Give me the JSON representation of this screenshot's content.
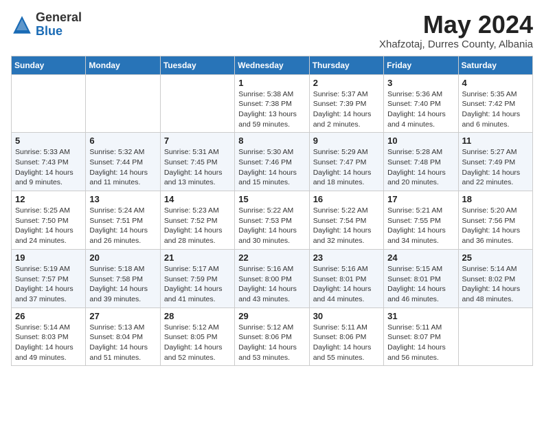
{
  "logo": {
    "general": "General",
    "blue": "Blue"
  },
  "title": {
    "month_year": "May 2024",
    "location": "Xhafzotaj, Durres County, Albania"
  },
  "headers": [
    "Sunday",
    "Monday",
    "Tuesday",
    "Wednesday",
    "Thursday",
    "Friday",
    "Saturday"
  ],
  "weeks": [
    [
      {
        "day": "",
        "info": ""
      },
      {
        "day": "",
        "info": ""
      },
      {
        "day": "",
        "info": ""
      },
      {
        "day": "1",
        "info": "Sunrise: 5:38 AM\nSunset: 7:38 PM\nDaylight: 13 hours\nand 59 minutes."
      },
      {
        "day": "2",
        "info": "Sunrise: 5:37 AM\nSunset: 7:39 PM\nDaylight: 14 hours\nand 2 minutes."
      },
      {
        "day": "3",
        "info": "Sunrise: 5:36 AM\nSunset: 7:40 PM\nDaylight: 14 hours\nand 4 minutes."
      },
      {
        "day": "4",
        "info": "Sunrise: 5:35 AM\nSunset: 7:42 PM\nDaylight: 14 hours\nand 6 minutes."
      }
    ],
    [
      {
        "day": "5",
        "info": "Sunrise: 5:33 AM\nSunset: 7:43 PM\nDaylight: 14 hours\nand 9 minutes."
      },
      {
        "day": "6",
        "info": "Sunrise: 5:32 AM\nSunset: 7:44 PM\nDaylight: 14 hours\nand 11 minutes."
      },
      {
        "day": "7",
        "info": "Sunrise: 5:31 AM\nSunset: 7:45 PM\nDaylight: 14 hours\nand 13 minutes."
      },
      {
        "day": "8",
        "info": "Sunrise: 5:30 AM\nSunset: 7:46 PM\nDaylight: 14 hours\nand 15 minutes."
      },
      {
        "day": "9",
        "info": "Sunrise: 5:29 AM\nSunset: 7:47 PM\nDaylight: 14 hours\nand 18 minutes."
      },
      {
        "day": "10",
        "info": "Sunrise: 5:28 AM\nSunset: 7:48 PM\nDaylight: 14 hours\nand 20 minutes."
      },
      {
        "day": "11",
        "info": "Sunrise: 5:27 AM\nSunset: 7:49 PM\nDaylight: 14 hours\nand 22 minutes."
      }
    ],
    [
      {
        "day": "12",
        "info": "Sunrise: 5:25 AM\nSunset: 7:50 PM\nDaylight: 14 hours\nand 24 minutes."
      },
      {
        "day": "13",
        "info": "Sunrise: 5:24 AM\nSunset: 7:51 PM\nDaylight: 14 hours\nand 26 minutes."
      },
      {
        "day": "14",
        "info": "Sunrise: 5:23 AM\nSunset: 7:52 PM\nDaylight: 14 hours\nand 28 minutes."
      },
      {
        "day": "15",
        "info": "Sunrise: 5:22 AM\nSunset: 7:53 PM\nDaylight: 14 hours\nand 30 minutes."
      },
      {
        "day": "16",
        "info": "Sunrise: 5:22 AM\nSunset: 7:54 PM\nDaylight: 14 hours\nand 32 minutes."
      },
      {
        "day": "17",
        "info": "Sunrise: 5:21 AM\nSunset: 7:55 PM\nDaylight: 14 hours\nand 34 minutes."
      },
      {
        "day": "18",
        "info": "Sunrise: 5:20 AM\nSunset: 7:56 PM\nDaylight: 14 hours\nand 36 minutes."
      }
    ],
    [
      {
        "day": "19",
        "info": "Sunrise: 5:19 AM\nSunset: 7:57 PM\nDaylight: 14 hours\nand 37 minutes."
      },
      {
        "day": "20",
        "info": "Sunrise: 5:18 AM\nSunset: 7:58 PM\nDaylight: 14 hours\nand 39 minutes."
      },
      {
        "day": "21",
        "info": "Sunrise: 5:17 AM\nSunset: 7:59 PM\nDaylight: 14 hours\nand 41 minutes."
      },
      {
        "day": "22",
        "info": "Sunrise: 5:16 AM\nSunset: 8:00 PM\nDaylight: 14 hours\nand 43 minutes."
      },
      {
        "day": "23",
        "info": "Sunrise: 5:16 AM\nSunset: 8:01 PM\nDaylight: 14 hours\nand 44 minutes."
      },
      {
        "day": "24",
        "info": "Sunrise: 5:15 AM\nSunset: 8:01 PM\nDaylight: 14 hours\nand 46 minutes."
      },
      {
        "day": "25",
        "info": "Sunrise: 5:14 AM\nSunset: 8:02 PM\nDaylight: 14 hours\nand 48 minutes."
      }
    ],
    [
      {
        "day": "26",
        "info": "Sunrise: 5:14 AM\nSunset: 8:03 PM\nDaylight: 14 hours\nand 49 minutes."
      },
      {
        "day": "27",
        "info": "Sunrise: 5:13 AM\nSunset: 8:04 PM\nDaylight: 14 hours\nand 51 minutes."
      },
      {
        "day": "28",
        "info": "Sunrise: 5:12 AM\nSunset: 8:05 PM\nDaylight: 14 hours\nand 52 minutes."
      },
      {
        "day": "29",
        "info": "Sunrise: 5:12 AM\nSunset: 8:06 PM\nDaylight: 14 hours\nand 53 minutes."
      },
      {
        "day": "30",
        "info": "Sunrise: 5:11 AM\nSunset: 8:06 PM\nDaylight: 14 hours\nand 55 minutes."
      },
      {
        "day": "31",
        "info": "Sunrise: 5:11 AM\nSunset: 8:07 PM\nDaylight: 14 hours\nand 56 minutes."
      },
      {
        "day": "",
        "info": ""
      }
    ]
  ]
}
